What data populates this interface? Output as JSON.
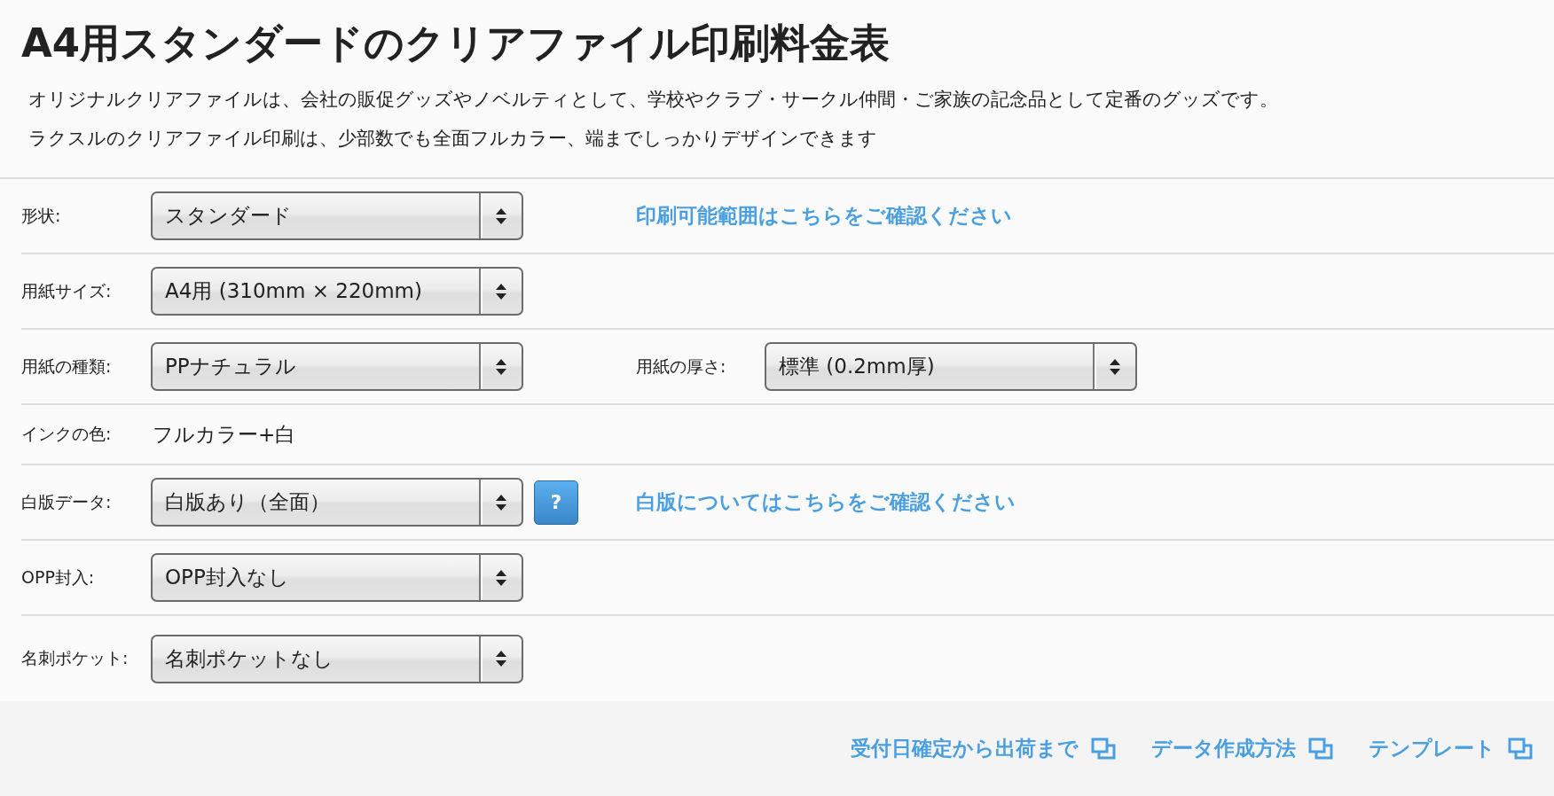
{
  "title": "A4用スタンダードのクリアファイル印刷料金表",
  "description": [
    "オリジナルクリアファイルは、会社の販促グッズやノベルティとして、学校やクラブ・サークル仲間・ご家族の記念品として定番のグッズです。",
    "ラクスルのクリアファイル印刷は、少部数でも全面フルカラー、端までしっかりデザインできます"
  ],
  "rows": [
    {
      "kind": "select",
      "label": "形状:",
      "value": "スタンダード",
      "link": "印刷可能範囲はこちらをご確認ください"
    },
    {
      "kind": "select",
      "label": "用紙サイズ:",
      "value": "A4用 (310mm × 220mm)"
    },
    {
      "kind": "select",
      "label": "用紙の種類:",
      "value": "PPナチュラル",
      "extra": {
        "label": "用紙の厚さ:",
        "value": "標準 (0.2mm厚)"
      }
    },
    {
      "kind": "text",
      "label": "インクの色:",
      "value": "フルカラー+白"
    },
    {
      "kind": "select",
      "label": "白版データ:",
      "value": "白版あり（全面）",
      "help": "?",
      "link": "白版についてはこちらをご確認ください"
    },
    {
      "kind": "select",
      "label": "OPP封入:",
      "value": "OPP封入なし"
    },
    {
      "kind": "select",
      "label": "名刺ポケット:",
      "value": "名刺ポケットなし"
    }
  ],
  "footer_links": [
    "受付日確定から出荷まで",
    "データ作成方法",
    "テンプレート"
  ]
}
